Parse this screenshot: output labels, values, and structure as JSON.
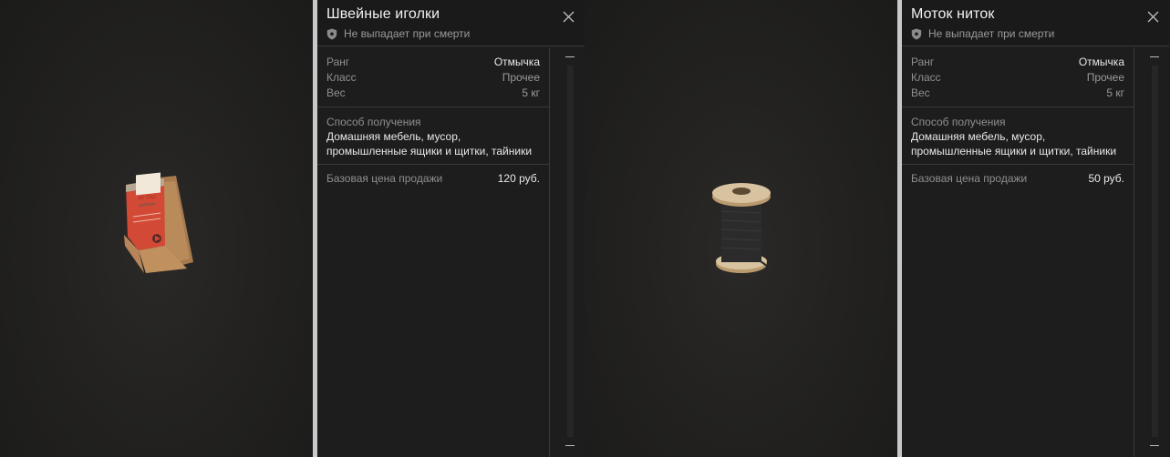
{
  "cards": [
    {
      "title": "Швейные иголки",
      "subtitle": "Не выпадает при смерти",
      "stats": [
        {
          "label": "Ранг",
          "value": "Отмычка"
        },
        {
          "label": "Класс",
          "value": "Прочее"
        },
        {
          "label": "Вес",
          "value": "5 кг"
        }
      ],
      "obtain_label": "Способ получения",
      "obtain_value": "Домашняя мебель, мусор, промышленные ящики и щитки, тайники",
      "price_label": "Базовая цена продажи",
      "price_value": "120 руб.",
      "image_icon": "needle-pack-image"
    },
    {
      "title": "Моток ниток",
      "subtitle": "Не выпадает при смерти",
      "stats": [
        {
          "label": "Ранг",
          "value": "Отмычка"
        },
        {
          "label": "Класс",
          "value": "Прочее"
        },
        {
          "label": "Вес",
          "value": "5 кг"
        }
      ],
      "obtain_label": "Способ получения",
      "obtain_value": "Домашняя мебель, мусор, промышленные ящики и щитки, тайники",
      "price_label": "Базовая цена продажи",
      "price_value": "50 руб.",
      "image_icon": "thread-spool-image"
    }
  ],
  "colors": {
    "accent_bar": "#c9c9c9",
    "panel_bg": "#1d1d1d",
    "divider": "#3a3a3a"
  },
  "icons": {
    "shield": "shield-icon",
    "close": "close-icon"
  },
  "needle_pack_lettering": [
    "ИГЛЫ",
    "ШВЕЙНЫЕ"
  ]
}
